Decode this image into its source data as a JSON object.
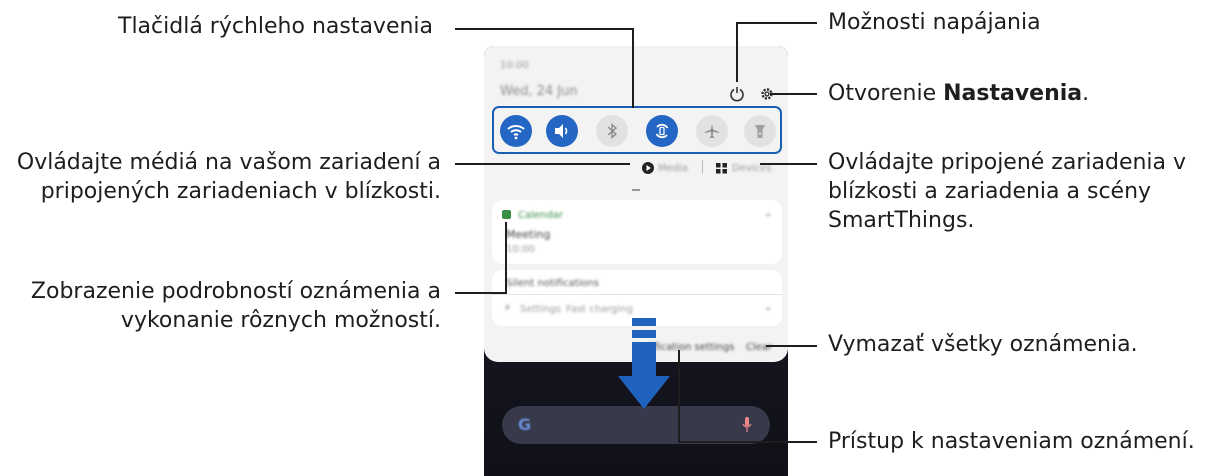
{
  "callouts": {
    "quick_settings": "Tlačidlá rýchleho nastavenia",
    "power_options": "Možnosti napájania",
    "open_settings_prefix": "Otvorenie ",
    "open_settings_bold": "Nastavenia",
    "open_settings_suffix": ".",
    "media_line1": "Ovládajte médiá na vašom zariadení a",
    "media_line2": "pripojených zariadeniach v blízkosti.",
    "devices_line1": "Ovládajte pripojené zariadenia v",
    "devices_line2": "blízkosti a zariadenia a scény",
    "devices_line3": "SmartThings.",
    "details_line1": "Zobrazenie podrobností oznámenia a",
    "details_line2": "vykonanie rôznych možností.",
    "clear_all": "Vymazať všetky oznámenia.",
    "notif_settings": "Prístup k nastaveniam oznámení."
  },
  "phone": {
    "time": "10:00",
    "date": "Wed, 24 Jun",
    "media_label": "Media",
    "devices_label": "Devices",
    "card1_app": "Calendar",
    "card1_title": "Meeting",
    "card1_sub": "10:00",
    "section_title": "Silent notifications",
    "silent_app": "Settings",
    "silent_text": "Fast charging",
    "notification_settings_btn": "Notification settings",
    "clear_btn": "Clear"
  },
  "colors": {
    "accent": "#2366c4",
    "callout_line": "#1e1e1e",
    "highlight_border": "#1b5fb5"
  },
  "quick_settings": [
    "wifi-icon",
    "sound-icon",
    "bluetooth-icon",
    "auto-rotate-icon",
    "airplane-icon",
    "flashlight-icon"
  ]
}
